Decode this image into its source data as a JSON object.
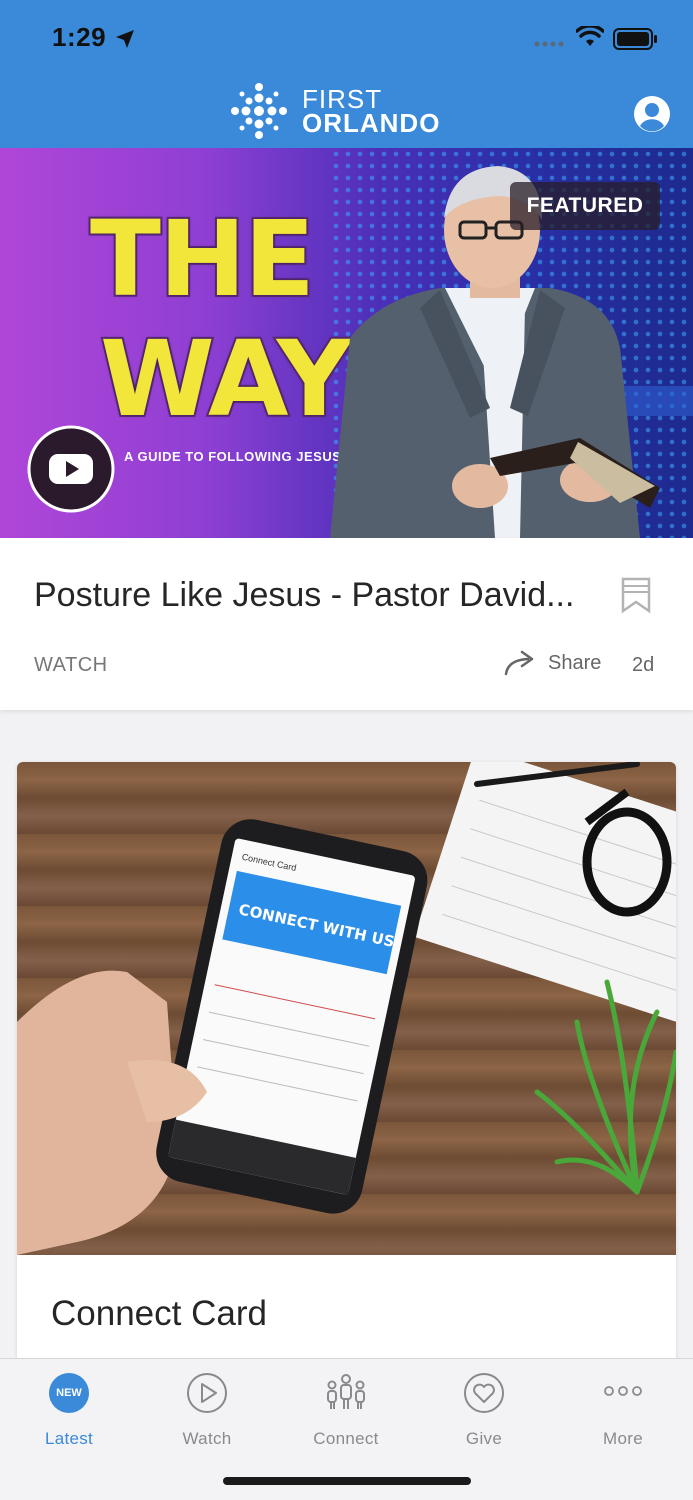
{
  "status_bar": {
    "time": "1:29"
  },
  "header": {
    "brand_line1": "FIRST",
    "brand_line2": "ORLANDO",
    "accent_color": "#3a8ad9"
  },
  "featured": {
    "badge": "FEATURED",
    "hero_title_line1": "THE",
    "hero_title_line2": "WAY",
    "hero_subtitle": "A GUIDE TO FOLLOWING JESUS",
    "title": "Posture Like Jesus - Pastor David...",
    "category": "WATCH",
    "share_label": "Share",
    "age": "2d"
  },
  "connect_card": {
    "image_header": "Connect Card",
    "image_banner": "CONNECT WITH US",
    "title": "Connect Card"
  },
  "tabbar": {
    "items": [
      {
        "label": "Latest",
        "badge": "NEW",
        "icon": "new-badge-icon",
        "active": true
      },
      {
        "label": "Watch",
        "icon": "play-circle-icon"
      },
      {
        "label": "Connect",
        "icon": "people-icon"
      },
      {
        "label": "Give",
        "icon": "heart-circle-icon"
      },
      {
        "label": "More",
        "icon": "more-dots-icon"
      }
    ]
  }
}
